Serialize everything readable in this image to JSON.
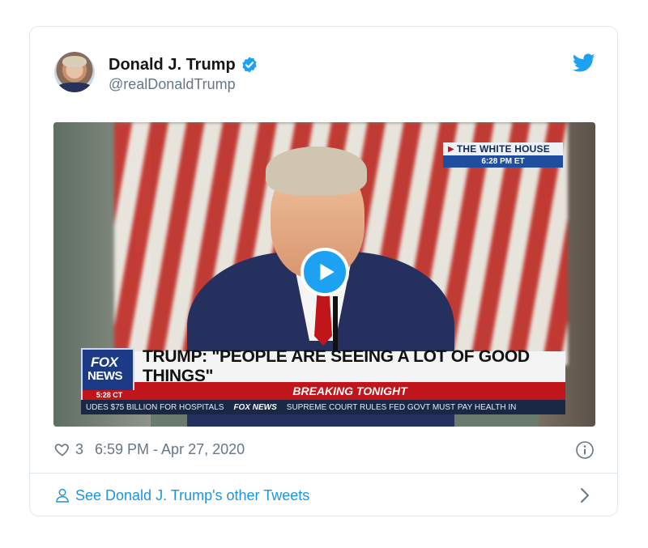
{
  "tweet": {
    "author_name": "Donald J. Trump",
    "handle": "@realDonaldTrump",
    "likes": "3",
    "timestamp": "6:59 PM - Apr 27, 2020",
    "footer_link": "See Donald J. Trump's other Tweets"
  },
  "video": {
    "location_label": "THE WHITE HOUSE",
    "location_time": "6:28 PM ET",
    "network_logo_line1": "FOX",
    "network_logo_line2": "NEWS",
    "network_time": "5:28 CT",
    "headline": "TRUMP: \"PEOPLE ARE SEEING A LOT OF GOOD THINGS\"",
    "breaking": "BREAKING TONIGHT",
    "ticker_left": "UDES $75 BILLION FOR HOSPITALS",
    "ticker_logo": "FOX NEWS",
    "ticker_right": "SUPREME COURT RULES FED GOVT MUST PAY HEALTH IN"
  },
  "icons": {
    "verified": "verified-badge-icon",
    "brand": "twitter-bird-icon",
    "like": "heart-icon",
    "info": "info-icon",
    "profile": "person-icon",
    "more": "chevron-right-icon",
    "play": "play-icon"
  },
  "colors": {
    "brand_blue": "#1da1f2",
    "link_blue": "#1b95e0",
    "muted_text": "#657786",
    "border": "#e1e8ed"
  }
}
